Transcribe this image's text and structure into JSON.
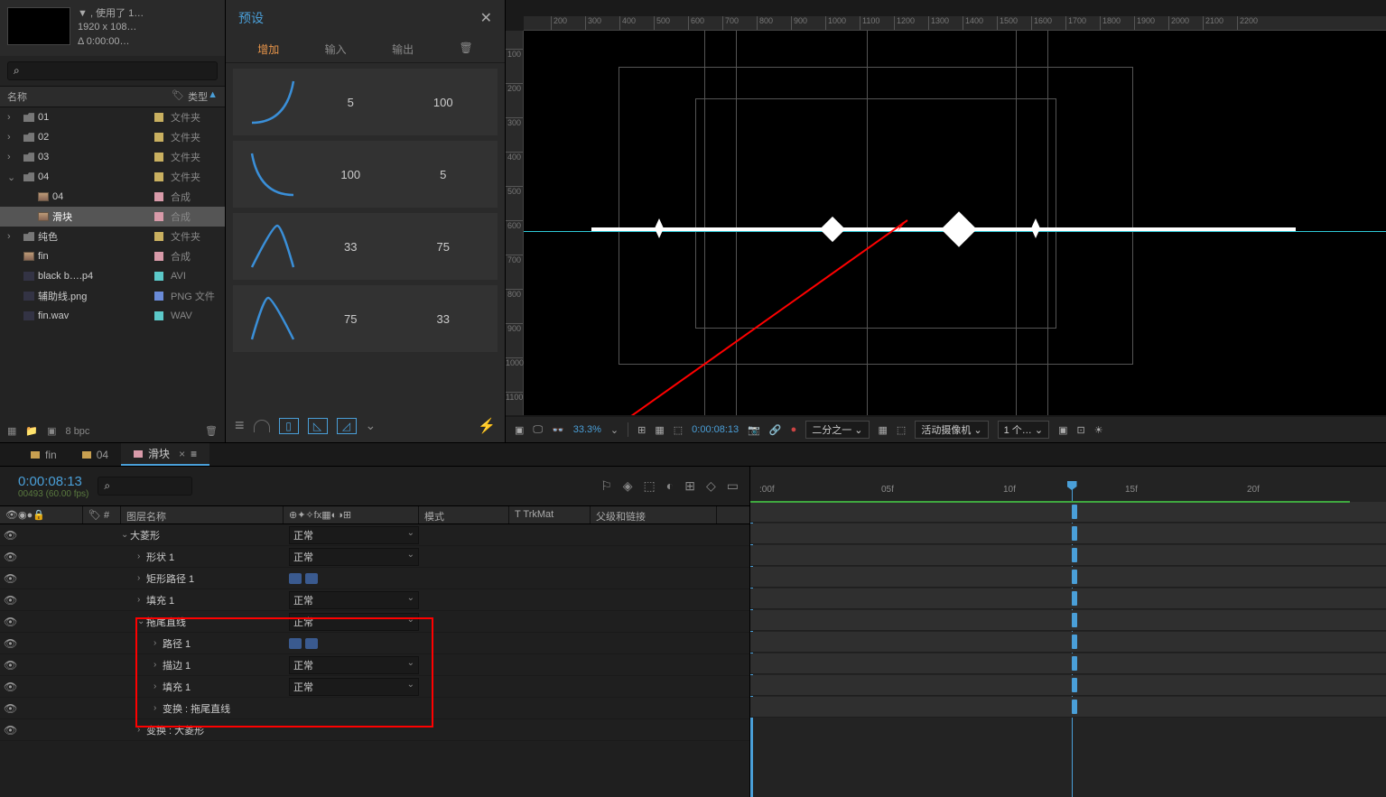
{
  "breadcrumb": {
    "root": "fin",
    "sep1": "‹",
    "mid": "04",
    "sep2": "‹",
    "current": "滑块",
    "right": "滑块 ·"
  },
  "project": {
    "meta_line1": "▼ , 使用了 1…",
    "meta_line2": "1920 x 108…",
    "meta_line3": "Δ 0:00:00…",
    "search_placeholder": "",
    "col_name": "名称",
    "col_type": "类型",
    "items": [
      {
        "tw": "›",
        "icon": "folder",
        "name": "01",
        "sw": "sw-sand",
        "type": "文件夹"
      },
      {
        "tw": "›",
        "icon": "folder",
        "name": "02",
        "sw": "sw-sand",
        "type": "文件夹"
      },
      {
        "tw": "›",
        "icon": "folder",
        "name": "03",
        "sw": "sw-sand",
        "type": "文件夹"
      },
      {
        "tw": "⌄",
        "icon": "folder",
        "name": "04",
        "sw": "sw-sand",
        "type": "文件夹"
      },
      {
        "tw": "",
        "icon": "comp",
        "name": "04",
        "indent": 1,
        "sw": "sw-pink",
        "type": "合成"
      },
      {
        "tw": "",
        "icon": "comp",
        "name": "滑块",
        "indent": 1,
        "sel": true,
        "sw": "sw-pink",
        "type": "合成"
      },
      {
        "tw": "›",
        "icon": "folder",
        "name": "纯色",
        "sw": "sw-sand",
        "type": "文件夹"
      },
      {
        "tw": "",
        "icon": "comp",
        "name": "fin",
        "sw": "sw-pink",
        "type": "合成"
      },
      {
        "tw": "",
        "icon": "file",
        "name": "black b….p4",
        "sw": "sw-aqua",
        "type": "AVI"
      },
      {
        "tw": "",
        "icon": "file",
        "name": "辅助线.png",
        "sw": "sw-blue",
        "type": "PNG 文件"
      },
      {
        "tw": "",
        "icon": "file",
        "name": "fin.wav",
        "sw": "sw-aqua",
        "type": "WAV"
      }
    ],
    "foot_bpc": "8 bpc"
  },
  "preset": {
    "title": "预设",
    "tabs": [
      "增加",
      "输入",
      "输出"
    ],
    "items": [
      {
        "a": "5",
        "b": "100"
      },
      {
        "a": "100",
        "b": "5"
      },
      {
        "a": "33",
        "b": "75"
      },
      {
        "a": "75",
        "b": "33"
      }
    ]
  },
  "ruler_h": [
    200,
    300,
    400,
    500,
    600,
    700,
    800,
    900,
    1000,
    1100,
    1200,
    1300,
    1400,
    1500,
    1600,
    1700,
    1800,
    1900,
    2000,
    2100,
    2200
  ],
  "ruler_v": [
    100,
    200,
    300,
    400,
    500,
    600,
    700,
    800,
    900,
    1000,
    1100
  ],
  "viewer": {
    "zoom": "33.3%",
    "time": "0:00:08:13",
    "res": "二分之一",
    "camera": "活动摄像机",
    "views": "1 个…"
  },
  "timeline": {
    "tabs": [
      {
        "label": "fin",
        "color": "sand"
      },
      {
        "label": "04",
        "color": "sand"
      },
      {
        "label": "滑块",
        "color": "coral",
        "active": true
      }
    ],
    "timecode": "0:00:08:13",
    "timecode_sub": "00493 (60.00 fps)",
    "search_placeholder": "",
    "ruler_ticks": [
      ":00f",
      "05f",
      "10f",
      "15f",
      "20f"
    ],
    "col_headers": {
      "layer_name": "图层名称",
      "mode": "模式",
      "trkmat": "TrkMat",
      "parent": "父级和链接"
    },
    "layers": [
      {
        "tw": "⌄",
        "name": "大菱形",
        "mode": "正常",
        "chips": false,
        "top": true
      },
      {
        "tw": "›",
        "name": "形状 1",
        "mode": "正常",
        "indent": 1
      },
      {
        "tw": "›",
        "name": "矩形路径 1",
        "mode": "",
        "chips": true,
        "indent": 1
      },
      {
        "tw": "›",
        "name": "填充 1",
        "mode": "正常",
        "indent": 1
      },
      {
        "tw": "⌄",
        "name": "拖尾直线",
        "mode": "正常",
        "indent": 1,
        "hl": true
      },
      {
        "tw": "›",
        "name": "路径 1",
        "mode": "",
        "chips": true,
        "indent": 2,
        "hl": true
      },
      {
        "tw": "›",
        "name": "描边 1",
        "mode": "正常",
        "indent": 2,
        "hl": true
      },
      {
        "tw": "›",
        "name": "填充 1",
        "mode": "正常",
        "indent": 2,
        "hl": true
      },
      {
        "tw": "›",
        "name": "变换 : 拖尾直线",
        "mode": "",
        "indent": 2,
        "hl": true
      },
      {
        "tw": "›",
        "name": "变换 : 大菱形",
        "mode": "",
        "indent": 1
      }
    ]
  }
}
